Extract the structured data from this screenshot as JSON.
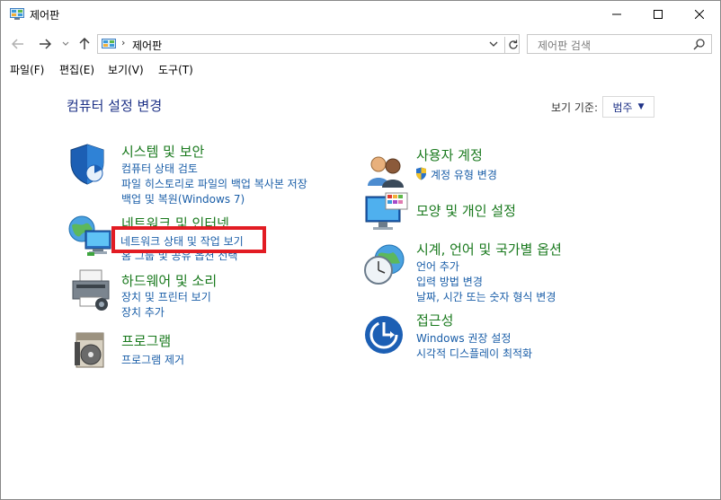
{
  "window": {
    "title": "제어판"
  },
  "address": {
    "crumb": "제어판",
    "separator": "›"
  },
  "search": {
    "placeholder": "제어판 검색"
  },
  "menu": [
    "파일(F)",
    "편집(E)",
    "보기(V)",
    "도구(T)"
  ],
  "content": {
    "title": "컴퓨터 설정 변경",
    "view_by_label": "보기 기준:",
    "view_by_value": "범주"
  },
  "left_categories": [
    {
      "title": "시스템 및 보안",
      "icon": "shield-icon",
      "links": [
        "컴퓨터 상태 검토",
        "파일 히스토리로 파일의 백업 복사본 저장",
        "백업 및 복원(Windows 7)"
      ]
    },
    {
      "title": "네트워크 및 인터넷",
      "icon": "network-globe-icon",
      "links": [
        "네트워크 상태 및 작업 보기",
        "홈 그룹 및 공유 옵션 선택"
      ]
    },
    {
      "title": "하드웨어 및 소리",
      "icon": "printer-icon",
      "links": [
        "장치 및 프린터 보기",
        "장치 추가"
      ]
    },
    {
      "title": "프로그램",
      "icon": "program-box-icon",
      "links": [
        "프로그램 제거"
      ]
    }
  ],
  "right_categories": [
    {
      "title": "사용자 계정",
      "icon": "users-icon",
      "links": [
        "계정 유형 변경"
      ]
    },
    {
      "title": "모양 및 개인 설정",
      "icon": "monitor-palette-icon",
      "links": []
    },
    {
      "title": "시계, 언어 및 국가별 옵션",
      "icon": "clock-globe-icon",
      "links": [
        "언어 추가",
        "입력 방법 변경",
        "날짜, 시간 또는 숫자 형식 변경"
      ]
    },
    {
      "title": "접근성",
      "icon": "accessibility-icon",
      "links": [
        "Windows 권장 설정",
        "시각적 디스플레이 최적화"
      ]
    }
  ],
  "highlight": {
    "label": "네트워크 상태 및 작업 보기",
    "color": "#e21c23"
  },
  "colors": {
    "category_title": "#19791d",
    "link": "#1a5ea8",
    "page_title": "#1e3287"
  }
}
